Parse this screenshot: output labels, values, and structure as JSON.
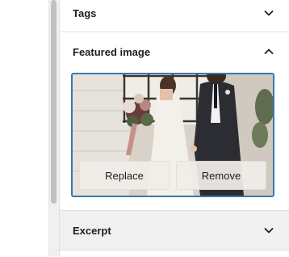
{
  "sidebar": {
    "tags": {
      "label": "Tags",
      "expanded": false,
      "icon": "chevron-down-icon"
    },
    "featured_image": {
      "label": "Featured image",
      "expanded": true,
      "icon": "chevron-up-icon",
      "replace_label": "Replace",
      "remove_label": "Remove"
    },
    "excerpt": {
      "label": "Excerpt",
      "expanded": false,
      "icon": "chevron-down-icon"
    }
  },
  "colors": {
    "focus_border": "#3a78ae",
    "divider": "#e0e0e0",
    "text": "#1e1e1e"
  }
}
